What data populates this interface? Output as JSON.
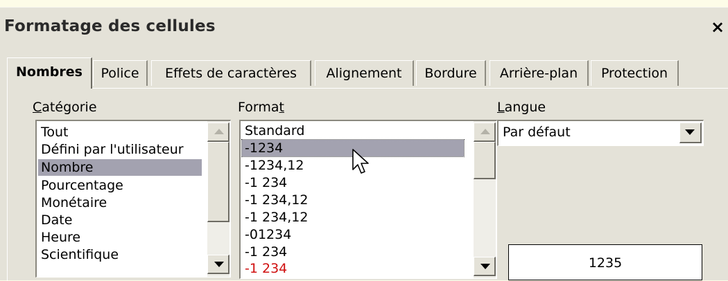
{
  "dialog": {
    "title": "Formatage des cellules",
    "close_glyph": "×"
  },
  "tabs": [
    {
      "label": "Nombres",
      "active": true
    },
    {
      "label": "Police",
      "active": false
    },
    {
      "label": "Effets de caractères",
      "active": false
    },
    {
      "label": "Alignement",
      "active": false
    },
    {
      "label": "Bordure",
      "active": false
    },
    {
      "label": "Arrière-plan",
      "active": false
    },
    {
      "label": "Protection",
      "active": false
    }
  ],
  "category": {
    "label_first": "C",
    "label_rest": "atégorie",
    "items": [
      "Tout",
      "Défini par l'utilisateur",
      "Nombre",
      "Pourcentage",
      "Monétaire",
      "Date",
      "Heure",
      "Scientifique"
    ],
    "selected": "Nombre"
  },
  "format": {
    "label_start": "Forma",
    "label_underlined": "t",
    "items": [
      "Standard",
      "-1234",
      "-1234,12",
      "-1 234",
      "-1 234,12",
      "-1 234,12",
      "-01234",
      "-1 234",
      "-1 234"
    ],
    "selected": "-1234",
    "red_item_note": "last item shown in red"
  },
  "language": {
    "label_first": "L",
    "label_rest": "angue",
    "value": "Par défaut"
  },
  "preview": {
    "value": "1235"
  },
  "icons": {
    "close": "close-icon",
    "scroll_up": "arrow-up-icon",
    "scroll_down": "arrow-down-icon",
    "dropdown": "chevron-down-icon",
    "pointer": "mouse-pointer-icon"
  },
  "colors": {
    "dialog_bg": "#e4e2d8",
    "selection": "#a3a2b0",
    "negative_red": "#d01010"
  }
}
